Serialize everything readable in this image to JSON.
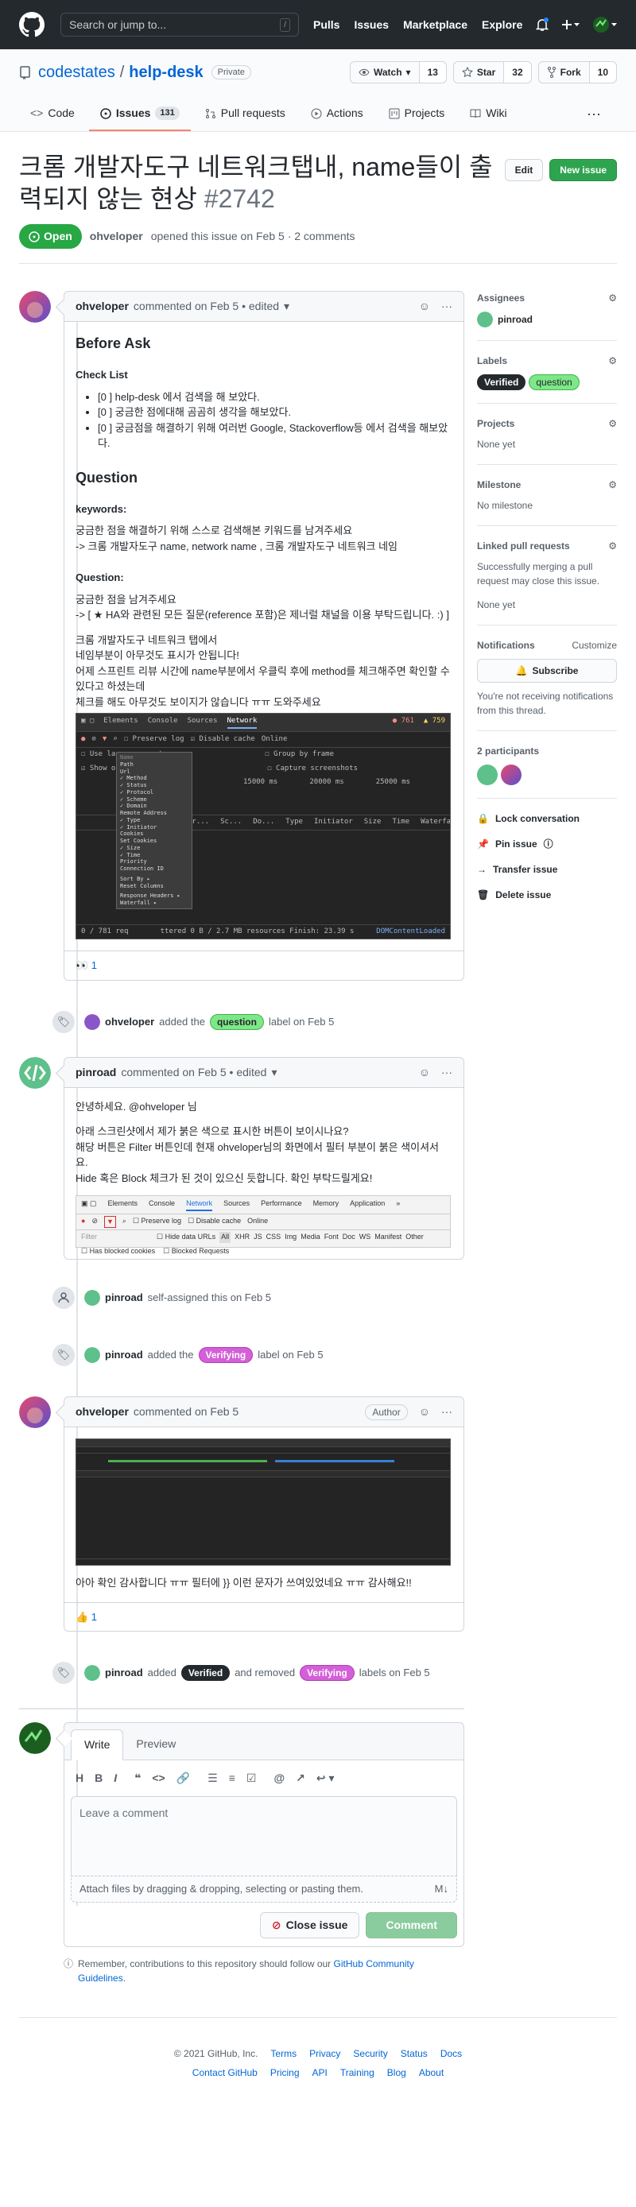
{
  "header": {
    "search_placeholder": "Search or jump to...",
    "slash": "/",
    "nav": [
      "Pulls",
      "Issues",
      "Marketplace",
      "Explore"
    ]
  },
  "repo": {
    "owner": "codestates",
    "sep": "/",
    "name": "help-desk",
    "visibility": "Private",
    "watch": "Watch",
    "watch_count": "13",
    "star": "Star",
    "star_count": "32",
    "fork": "Fork",
    "fork_count": "10"
  },
  "tabs": {
    "code": "Code",
    "issues": "Issues",
    "issues_count": "131",
    "pulls": "Pull requests",
    "actions": "Actions",
    "projects": "Projects",
    "wiki": "Wiki",
    "more": "···"
  },
  "issue": {
    "title": "크롬 개발자도구 네트워크탭내, name들이 출력되지 않는 현상",
    "number": "#2742",
    "edit": "Edit",
    "new_issue": "New issue",
    "state": "Open",
    "author": "ohveloper",
    "meta": "opened this issue on Feb 5 · 2 comments"
  },
  "comment1": {
    "author": "ohveloper",
    "meta": "commented on Feb 5 • edited",
    "h_before": "Before Ask",
    "h_check": "Check List",
    "checks": [
      "[0 ] help-desk 에서 검색을 해 보았다.",
      "[0 ] 궁금한 점에대해 곰곰히 생각을 해보았다.",
      "[0 ] 궁금점을 해결하기 위해 여러번 Google, Stackoverflow등 에서 검색을 해보았다."
    ],
    "h_question": "Question",
    "h_keywords": "keywords:",
    "kw1": "궁금한 점을 해결하기 위해 스스로 검색해본 키워드를 남겨주세요",
    "kw2": "-> 크롬 개발자도구 name, network name , 크롬 개발자도구 네트워크 네임",
    "h_q": "Question:",
    "q1": "궁금한 점을 남겨주세요",
    "q2": "-> [ ★ HA와 관련된 모든 질문(reference 포함)은 제너럴 채널을 이용 부탁드립니다. :) ]",
    "body1": "크롬 개발자도구 네트워크 탭에서",
    "body2": "네임부분이 아무것도 표시가 안됩니다!",
    "body3": "어제 스프린트 리뷰 시간에 name부분에서 우클릭 후에 method를 체크해주면 확인할 수 있다고 하셨는데",
    "body4": "체크를 해도 아무것도 보이지가 않습니다 ㅠㅠ 도와주세요",
    "reaction": "👀 1"
  },
  "devtools1": {
    "tabs": [
      "Elements",
      "Console",
      "Sources",
      "Network"
    ],
    "errors": "761",
    "warnings": "759",
    "preserve": "Preserve log",
    "disable": "Disable cache",
    "online": "Online",
    "large": "Use large request rows",
    "showov": "Show ov",
    "group": "Group by frame",
    "capture": "Capture screenshots",
    "t1": "15000 ms",
    "t2": "20000 ms",
    "t3": "25000 ms",
    "cols": [
      "Pr...",
      "Sc...",
      "Do...",
      "Type",
      "Initiator",
      "Size",
      "Time",
      "Waterfall"
    ],
    "menu": [
      "Name",
      "Path",
      "Url",
      "✓ Method",
      "✓ Status",
      "✓ Protocol",
      "✓ Scheme",
      "✓ Domain",
      "Remote Address",
      "✓ Type",
      "✓ Initiator",
      "Cookies",
      "Set Cookies",
      "✓ Size",
      "✓ Time",
      "Priority",
      "Connection ID",
      "Sort By ▸",
      "Reset Columns",
      "Response Headers ▸",
      "Waterfall ▸"
    ],
    "status": "0 / 781 req",
    "status2": "ttered   0 B / 2.7 MB resources   Finish: 23.39 s",
    "dom": "DOMContentLoaded"
  },
  "event1": {
    "actor": "ohveloper",
    "pre": "added the",
    "label": "question",
    "post": "label on Feb 5"
  },
  "comment2": {
    "author": "pinroad",
    "meta": "commented on Feb 5 • edited",
    "p1": "안녕하세요. @ohveloper 님",
    "p2": "아래 스크린샷에서 제가 붉은 색으로 표시한 버튼이 보이시나요?",
    "p3": "해당 버튼은 Filter 버튼인데 현재 ohveloper님의 화면에서 필터 부분이 붉은 색이셔서 요.",
    "p4": "Hide 혹은 Block 체크가 된 것이 있으신 듯합니다. 확인 부탁드릴게요!"
  },
  "devtools2": {
    "tabs": [
      "Elements",
      "Console",
      "Network",
      "Sources",
      "Performance",
      "Memory",
      "Application",
      "»"
    ],
    "preserve": "Preserve log",
    "disable": "Disable cache",
    "online": "Online",
    "filter": "Filter",
    "hide": "Hide data URLs",
    "types": [
      "All",
      "XHR",
      "JS",
      "CSS",
      "Img",
      "Media",
      "Font",
      "Doc",
      "WS",
      "Manifest",
      "Other"
    ],
    "blocked": "Has blocked cookies",
    "blockedreq": "Blocked Requests"
  },
  "event2": {
    "actor": "pinroad",
    "text": "self-assigned this on Feb 5"
  },
  "event3": {
    "actor": "pinroad",
    "pre": "added the",
    "label": "Verifying",
    "post": "label on Feb 5"
  },
  "comment3": {
    "author": "ohveloper",
    "meta": "commented on Feb 5",
    "badge": "Author",
    "body": "아아 확인 감사합니다 ㅠㅠ 필터에 }} 이런 문자가 쓰여있었네요 ㅠㅠ 감사해요!!",
    "reaction": "👍 1"
  },
  "event4": {
    "actor": "pinroad",
    "pre": "added",
    "label1": "Verified",
    "mid": "and removed",
    "label2": "Verifying",
    "post": "labels on Feb 5"
  },
  "composer": {
    "write": "Write",
    "preview": "Preview",
    "placeholder": "Leave a comment",
    "attach": "Attach files by dragging & dropping, selecting or pasting them.",
    "close": "Close issue",
    "submit": "Comment",
    "notice_pre": "Remember, contributions to this repository should follow our",
    "notice_link": "GitHub Community Guidelines",
    "notice_post": "."
  },
  "sidebar": {
    "assignees": "Assignees",
    "assignee": "pinroad",
    "labels": "Labels",
    "label_verified": "Verified",
    "label_question": "question",
    "projects": "Projects",
    "projects_none": "None yet",
    "milestone": "Milestone",
    "milestone_none": "No milestone",
    "linked": "Linked pull requests",
    "linked_desc": "Successfully merging a pull request may close this issue.",
    "linked_none": "None yet",
    "notifications": "Notifications",
    "customize": "Customize",
    "subscribe": "Subscribe",
    "notif_desc": "You're not receiving notifications from this thread.",
    "participants": "2 participants",
    "lock": "Lock conversation",
    "pin": "Pin issue",
    "transfer": "Transfer issue",
    "delete": "Delete issue"
  },
  "footer": {
    "copyright": "© 2021 GitHub, Inc.",
    "row1": [
      "Terms",
      "Privacy",
      "Security",
      "Status",
      "Docs"
    ],
    "row2": [
      "Contact GitHub",
      "Pricing",
      "API",
      "Training",
      "Blog",
      "About"
    ]
  },
  "colors": {
    "question": "#7ee787",
    "verifying": "#d45fd8",
    "verified": "#24292e",
    "green": "#2ea44f",
    "accent": "#0366d6"
  }
}
